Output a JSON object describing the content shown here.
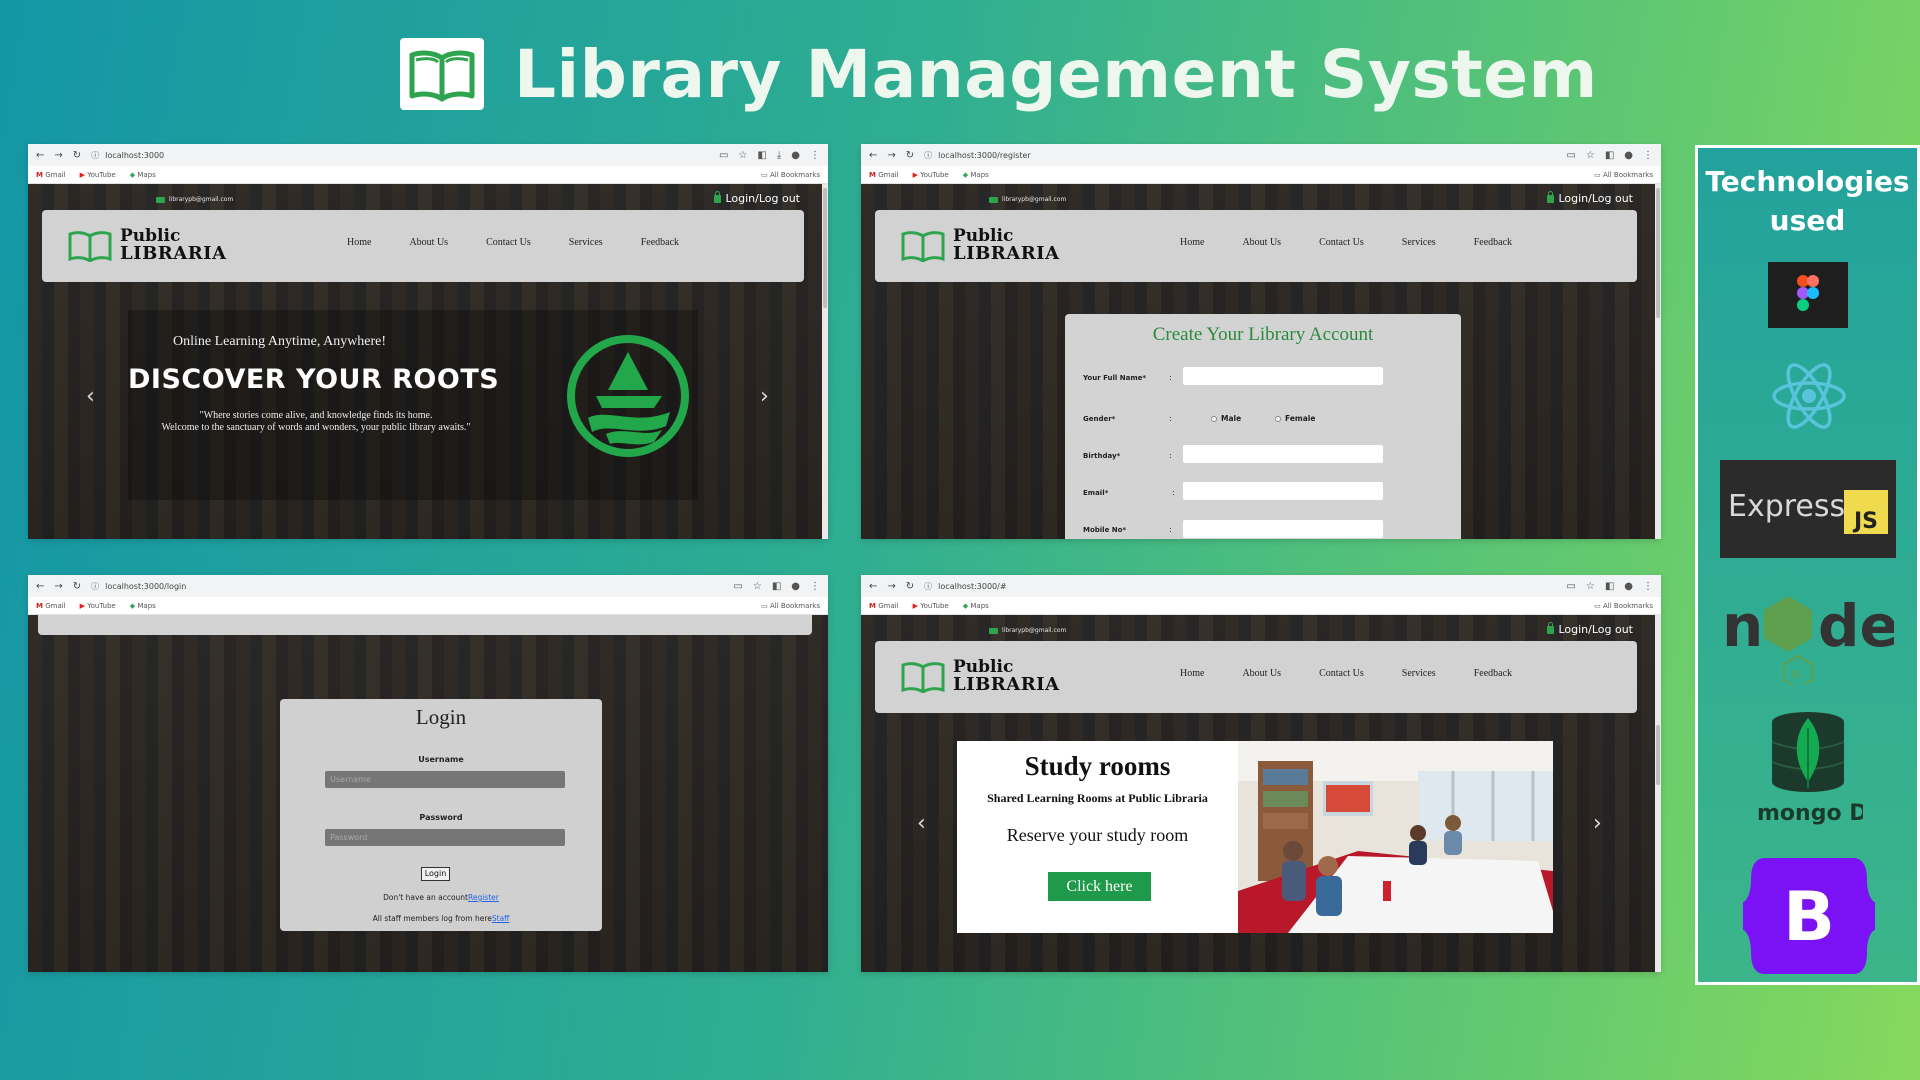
{
  "header": {
    "title": "Library Management System"
  },
  "browsers": {
    "bookmarks": {
      "gmail": "Gmail",
      "youtube": "YouTube",
      "maps": "Maps",
      "all": "All Bookmarks"
    },
    "b1": {
      "url": "localhost:3000"
    },
    "b2": {
      "url": "localhost:3000/register"
    },
    "b3": {
      "url": "localhost:3000/login"
    },
    "b4": {
      "url": "localhost:3000/#"
    }
  },
  "site": {
    "email": "librarypb@gmail.com",
    "login_link": "Login/Log out",
    "brand_line1": "Public",
    "brand_line2": "LIBRARIA",
    "nav": {
      "home": "Home",
      "about": "About Us",
      "contact": "Contact Us",
      "services": "Services",
      "feedback": "Feedback"
    }
  },
  "hero": {
    "subtitle": "Online Learning Anytime, Anywhere!",
    "title": "DISCOVER YOUR ROOTS",
    "quote1": "\"Where stories come alive, and knowledge finds its home.",
    "quote2": "Welcome to the sanctuary of words and wonders, your public library awaits.\""
  },
  "register": {
    "title": "Create Your Library Account",
    "full_name": "Your Full Name*",
    "gender": "Gender*",
    "male": "Male",
    "female": "Female",
    "birthday": "Birthday*",
    "email": "Email*",
    "mobile": "Mobile No*",
    "colon": ":"
  },
  "login": {
    "title": "Login",
    "username_label": "Username",
    "username_placeholder": "Username",
    "password_label": "Password",
    "password_placeholder": "Password",
    "button": "Login",
    "no_account": "Don't have an account",
    "register_link": "Register",
    "staff_note": "All staff members log from here",
    "staff_link": "Staff"
  },
  "study": {
    "title": "Study rooms",
    "subtitle": "Shared Learning Rooms at Public Libraria",
    "reserve": "Reserve your study room",
    "button": "Click here"
  },
  "tech": {
    "title_line1": "Technologies",
    "title_line2": "used",
    "logos": [
      "figma-icon",
      "react-icon",
      "express-js-logo",
      "nodejs-logo",
      "mongodb-logo",
      "bootstrap-logo"
    ]
  },
  "colors": {
    "accent_green": "#1e9a4a",
    "brand_green": "#2a8a3e",
    "bootstrap": "#7b12f5"
  }
}
